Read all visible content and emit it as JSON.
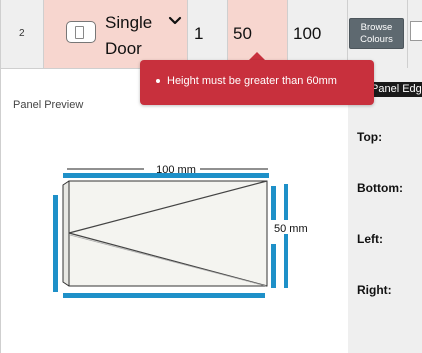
{
  "row": {
    "number": "2",
    "type_label_line1": "Single",
    "type_label_line2": "Door",
    "quantity": "1",
    "height": "50",
    "width": "100",
    "browse_line1": "Browse",
    "browse_line2": "Colours"
  },
  "tooltip": {
    "message": "Height must be greater than 60mm"
  },
  "preview": {
    "title": "Panel Preview",
    "width_label": "100 mm",
    "height_label": "50 mm"
  },
  "edging": {
    "header": "Panel Edging",
    "top": "Top:",
    "bottom": "Bottom:",
    "left": "Left:",
    "right": "Right:"
  },
  "colors": {
    "highlight": "#f7d6cf",
    "error": "#c8303d",
    "edge_band": "#1e90c8",
    "button": "#5e6970"
  },
  "icons": [
    "door-thumbnail-icon",
    "chevron-down-icon"
  ]
}
